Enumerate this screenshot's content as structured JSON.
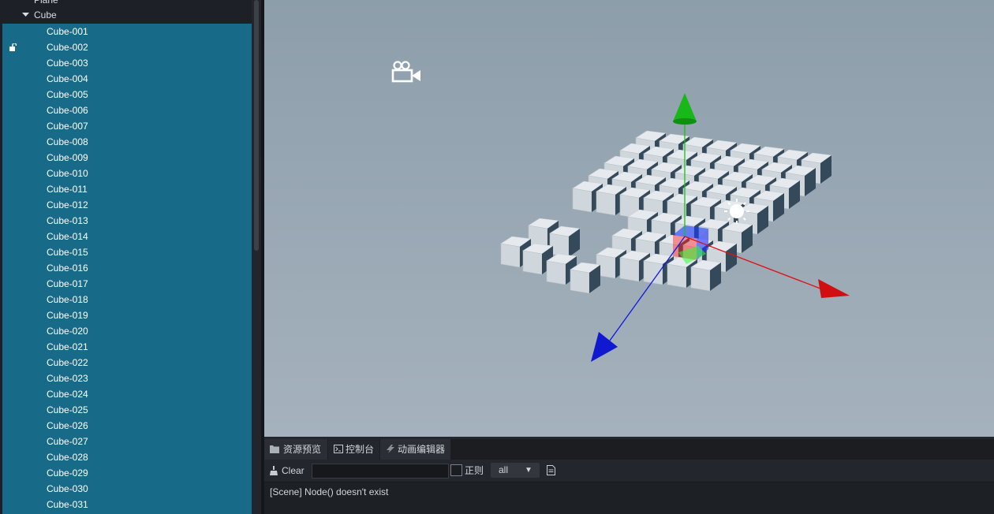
{
  "hierarchy": {
    "plane_label": "Plane",
    "cube_group_label": "Cube",
    "cubes": [
      "Cube-001",
      "Cube-002",
      "Cube-003",
      "Cube-004",
      "Cube-005",
      "Cube-006",
      "Cube-007",
      "Cube-008",
      "Cube-009",
      "Cube-010",
      "Cube-011",
      "Cube-012",
      "Cube-013",
      "Cube-014",
      "Cube-015",
      "Cube-016",
      "Cube-017",
      "Cube-018",
      "Cube-019",
      "Cube-020",
      "Cube-021",
      "Cube-022",
      "Cube-023",
      "Cube-024",
      "Cube-025",
      "Cube-026",
      "Cube-027",
      "Cube-028",
      "Cube-029",
      "Cube-030",
      "Cube-031"
    ],
    "locked_item": "Cube-002",
    "selection_color": "#176b89"
  },
  "scene": {
    "camera_icon": "camera-icon",
    "light_icon": "sun-light-icon",
    "gizmo_colors": {
      "x": "#e01010",
      "y": "#18c018",
      "z": "#1018e0"
    }
  },
  "bottom_panel": {
    "tabs": [
      {
        "label": "资源预览",
        "icon": "folder-icon"
      },
      {
        "label": "控制台",
        "icon": "console-icon"
      },
      {
        "label": "动画编辑器",
        "icon": "animation-icon"
      }
    ],
    "active_tab": "控制台",
    "toolbar": {
      "clear_label": "Clear",
      "filter_value": "",
      "regex_label": "正则",
      "level_value": "all"
    },
    "logs": [
      "[Scene] Node() doesn't exist"
    ]
  }
}
